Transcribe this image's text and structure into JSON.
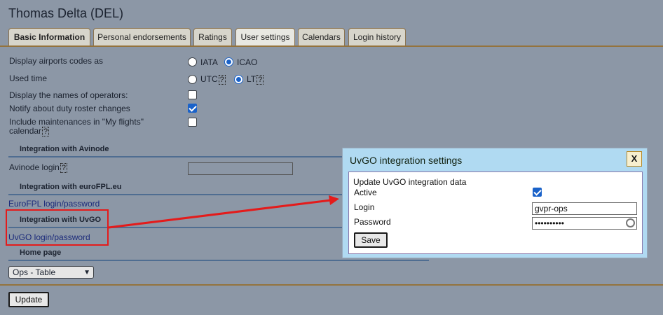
{
  "page_title": "Thomas Delta (DEL)",
  "tabs": [
    {
      "label": "Basic Information"
    },
    {
      "label": "Personal endorsements"
    },
    {
      "label": "Ratings"
    },
    {
      "label": "User settings"
    },
    {
      "label": "Calendars"
    },
    {
      "label": "Login history"
    }
  ],
  "settings": {
    "airport_codes": {
      "label": "Display airports codes as",
      "options": [
        "IATA",
        "ICAO"
      ],
      "selected": "ICAO"
    },
    "used_time": {
      "label": "Used time",
      "options": [
        "UTC",
        "LT"
      ],
      "selected": "LT",
      "help": "?"
    },
    "operator_names": {
      "label": "Display the names of operators:",
      "checked": false
    },
    "duty_roster": {
      "label": "Notify about duty roster changes",
      "checked": true
    },
    "maintenances": {
      "label_line1": "Include maintenances in \"My flights\"",
      "label_line2": "calendar",
      "help": "?",
      "checked": false
    }
  },
  "sections": {
    "avinode": {
      "heading": "Integration with Avinode",
      "login_label": "Avinode login",
      "help": "?",
      "login_value": ""
    },
    "eurofpl": {
      "heading": "Integration with euroFPL.eu",
      "link": "EuroFPL login/password"
    },
    "uvgo": {
      "heading": "Integration with UvGO",
      "link": "UvGO login/password"
    },
    "home": {
      "heading": "Home page",
      "selected": "Ops - Table"
    }
  },
  "update_button": "Update",
  "dialog": {
    "title": "UvGO integration settings",
    "close": "X",
    "subtitle": "Update UvGO integration data",
    "active_label": "Active",
    "active_checked": true,
    "login_label": "Login",
    "login_value": "gvpr-ops",
    "password_label": "Password",
    "password_value": "••••••••••",
    "save_button": "Save"
  },
  "colors": {
    "background": "#8c97a6",
    "accent_line": "#94733d",
    "section_line": "#4f6d91",
    "highlight": "#e41b1b",
    "dialog_bg": "#b0daf2",
    "checkbox": "#1a62c9"
  }
}
